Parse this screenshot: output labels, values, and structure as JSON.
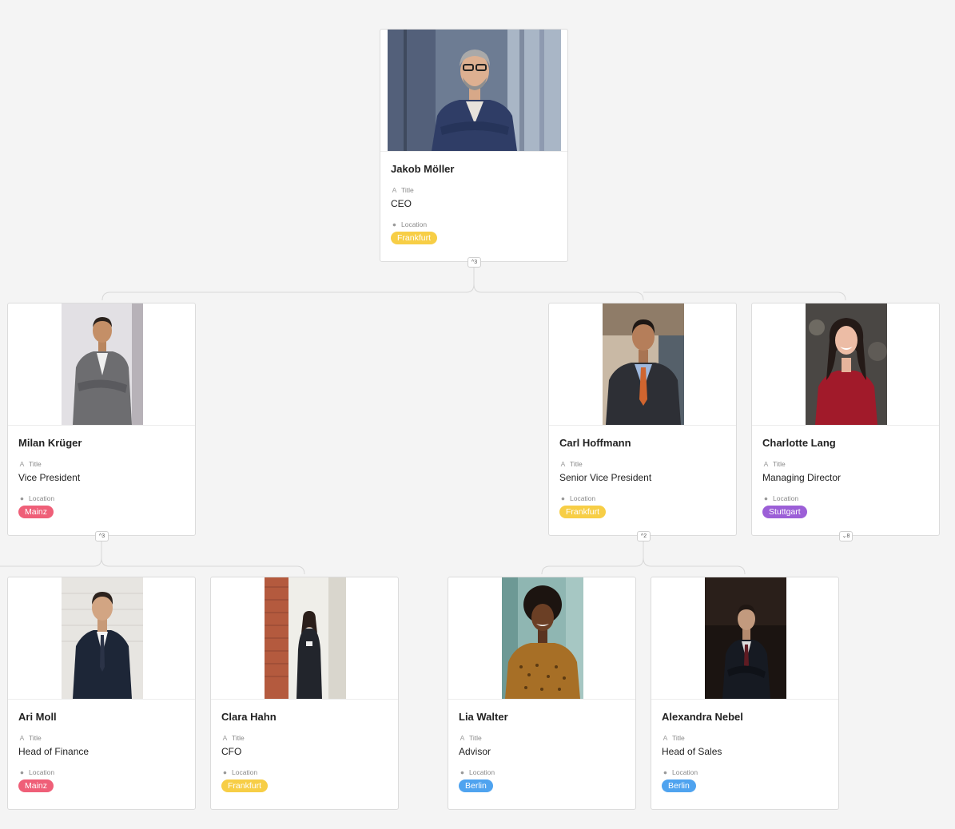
{
  "labels": {
    "title_label": "Title",
    "location_label": "Location"
  },
  "icons": {
    "title_icon": "text-field-icon",
    "location_icon": "single-select-icon"
  },
  "location_colors": {
    "Frankfurt": "#f7ce46",
    "Mainz": "#ef5f78",
    "Stuttgart": "#9c5fd7",
    "Berlin": "#4fa3ef"
  },
  "people": {
    "jakob": {
      "name": "Jakob Möller",
      "title": "CEO",
      "location": "Frankfurt",
      "toggle": "^3"
    },
    "milan": {
      "name": "Milan Krüger",
      "title": "Vice President",
      "location": "Mainz",
      "toggle": "^3"
    },
    "carl": {
      "name": "Carl Hoffmann",
      "title": "Senior Vice President",
      "location": "Frankfurt",
      "toggle": "^2"
    },
    "charlotte": {
      "name": "Charlotte Lang",
      "title": "Managing Director",
      "location": "Stuttgart",
      "toggle": "⌄8"
    },
    "ari": {
      "name": "Ari Moll",
      "title": "Head of Finance",
      "location": "Mainz"
    },
    "clara": {
      "name": "Clara Hahn",
      "title": "CFO",
      "location": "Frankfurt"
    },
    "lia": {
      "name": "Lia Walter",
      "title": "Advisor",
      "location": "Berlin"
    },
    "alexandra": {
      "name": "Alexandra Nebel",
      "title": "Head of Sales",
      "location": "Berlin"
    }
  }
}
